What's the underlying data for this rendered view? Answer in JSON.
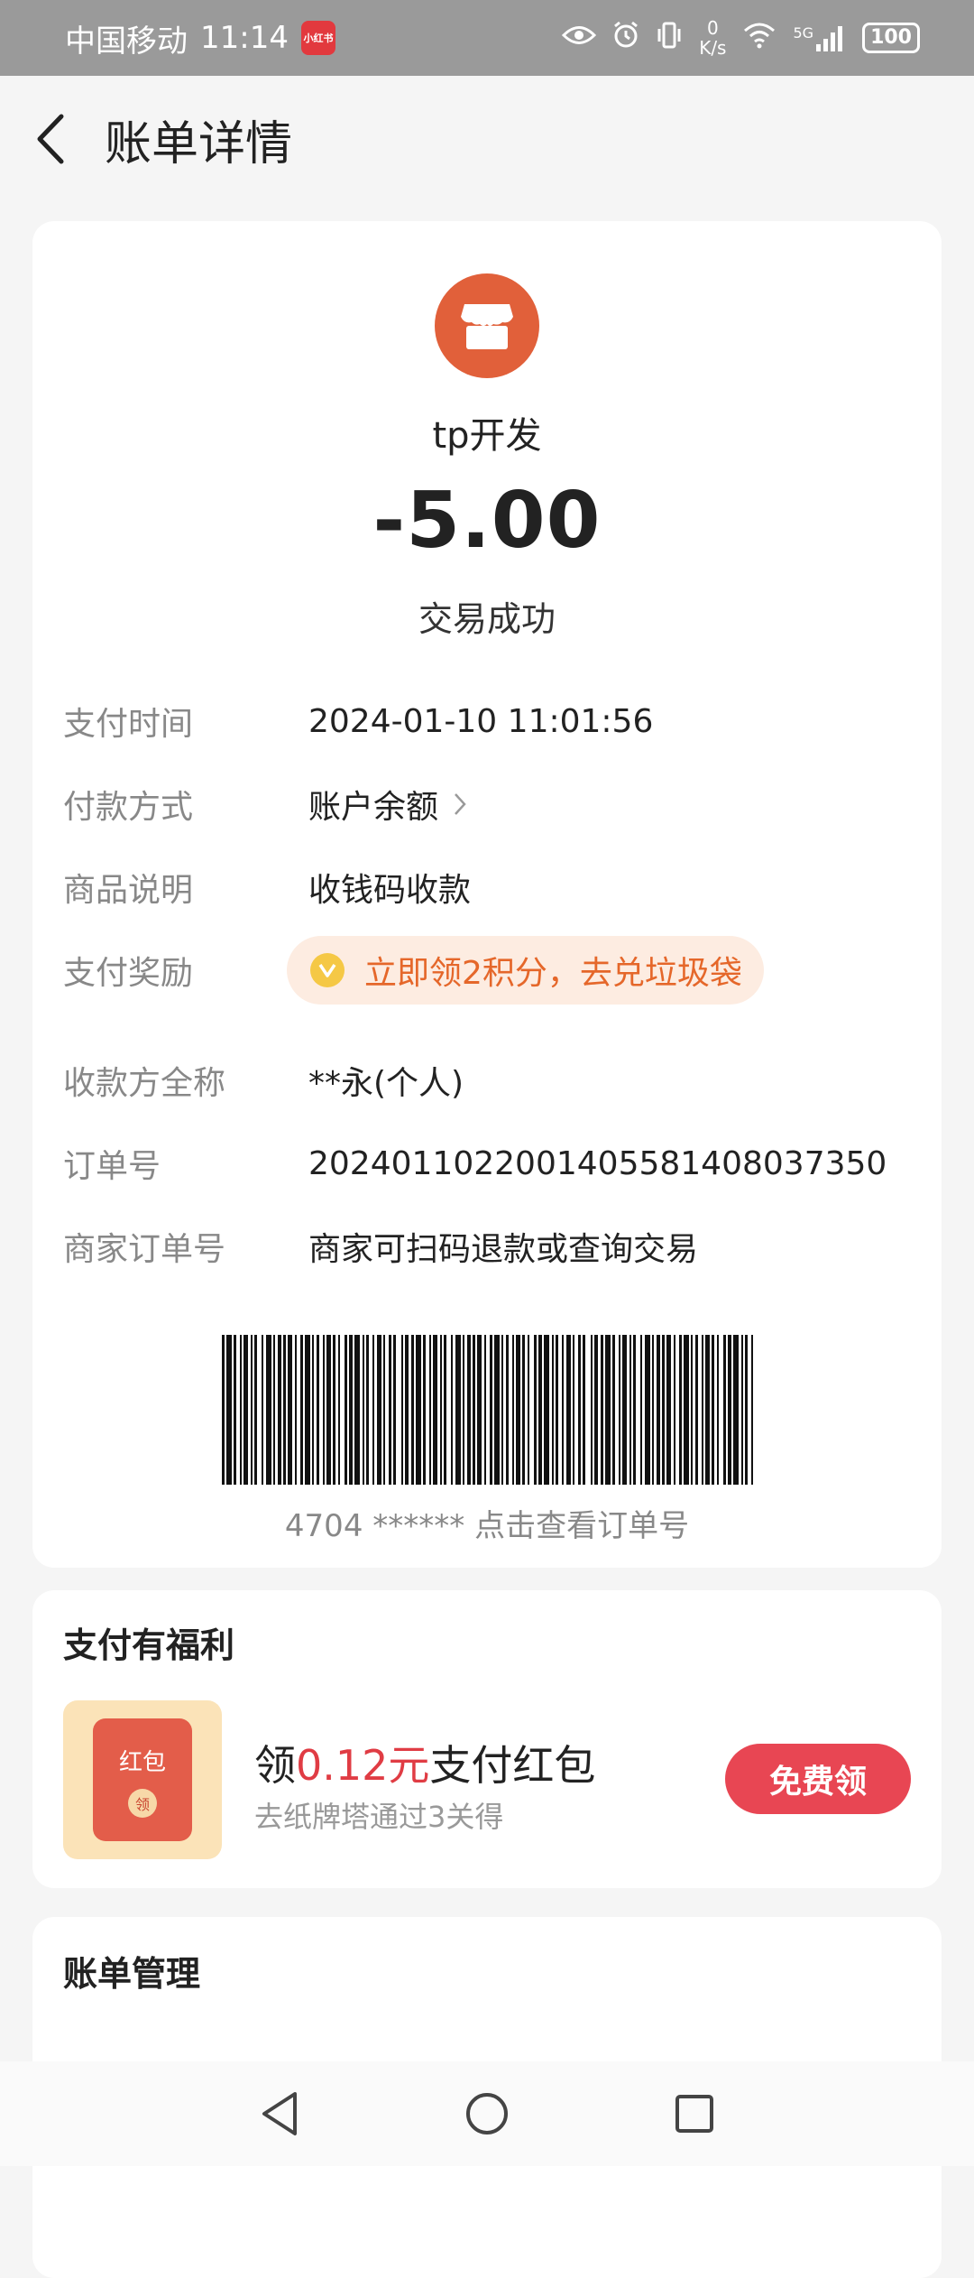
{
  "status_bar": {
    "carrier": "中国移动",
    "time": "11:14",
    "app_badge": "小红书",
    "net_speed_value": "0",
    "net_speed_unit": "K/s",
    "signal_label": "5G",
    "battery": "100"
  },
  "header": {
    "title": "账单详情"
  },
  "transaction": {
    "merchant_name": "tp开发",
    "amount": "-5.00",
    "status": "交易成功"
  },
  "details": {
    "pay_time": {
      "label": "支付时间",
      "value": "2024-01-10 11:01:56"
    },
    "pay_method": {
      "label": "付款方式",
      "value": "账户余额"
    },
    "item_desc": {
      "label": "商品说明",
      "value": "收钱码收款"
    },
    "reward": {
      "label": "支付奖励",
      "value": "立即领2积分，去兑垃圾袋"
    },
    "payee": {
      "label": "收款方全称",
      "value": "**永(个人)"
    },
    "order_no": {
      "label": "订单号",
      "value": "2024011022001405581408037350"
    },
    "merchant_order": {
      "label": "商家订单号",
      "value": "商家可扫码退款或查询交易"
    }
  },
  "barcode": {
    "caption": "4704 ****** 点击查看订单号"
  },
  "benefit": {
    "title": "支付有福利",
    "thumb_label": "红包",
    "thumb_seal": "领",
    "promo_prefix": "领",
    "promo_amount": "0.12元",
    "promo_suffix": "支付红包",
    "promo_sub": "去纸牌塔通过3关得",
    "button_label": "免费领"
  },
  "manage": {
    "title": "账单管理"
  },
  "colors": {
    "accent_red": "#e84653",
    "merchant_orange": "#e1603a",
    "reward_orange": "#e5672a",
    "card_bg": "#ffffff",
    "page_bg": "#f5f5f5"
  },
  "icons": [
    "back-arrow-icon",
    "store-icon",
    "chevron-right-icon",
    "coin-icon",
    "red-packet-icon",
    "nav-back-icon",
    "nav-home-icon",
    "nav-recents-icon",
    "eye-icon",
    "alarm-icon",
    "vibrate-icon",
    "wifi-icon",
    "signal-icon",
    "battery-icon"
  ]
}
